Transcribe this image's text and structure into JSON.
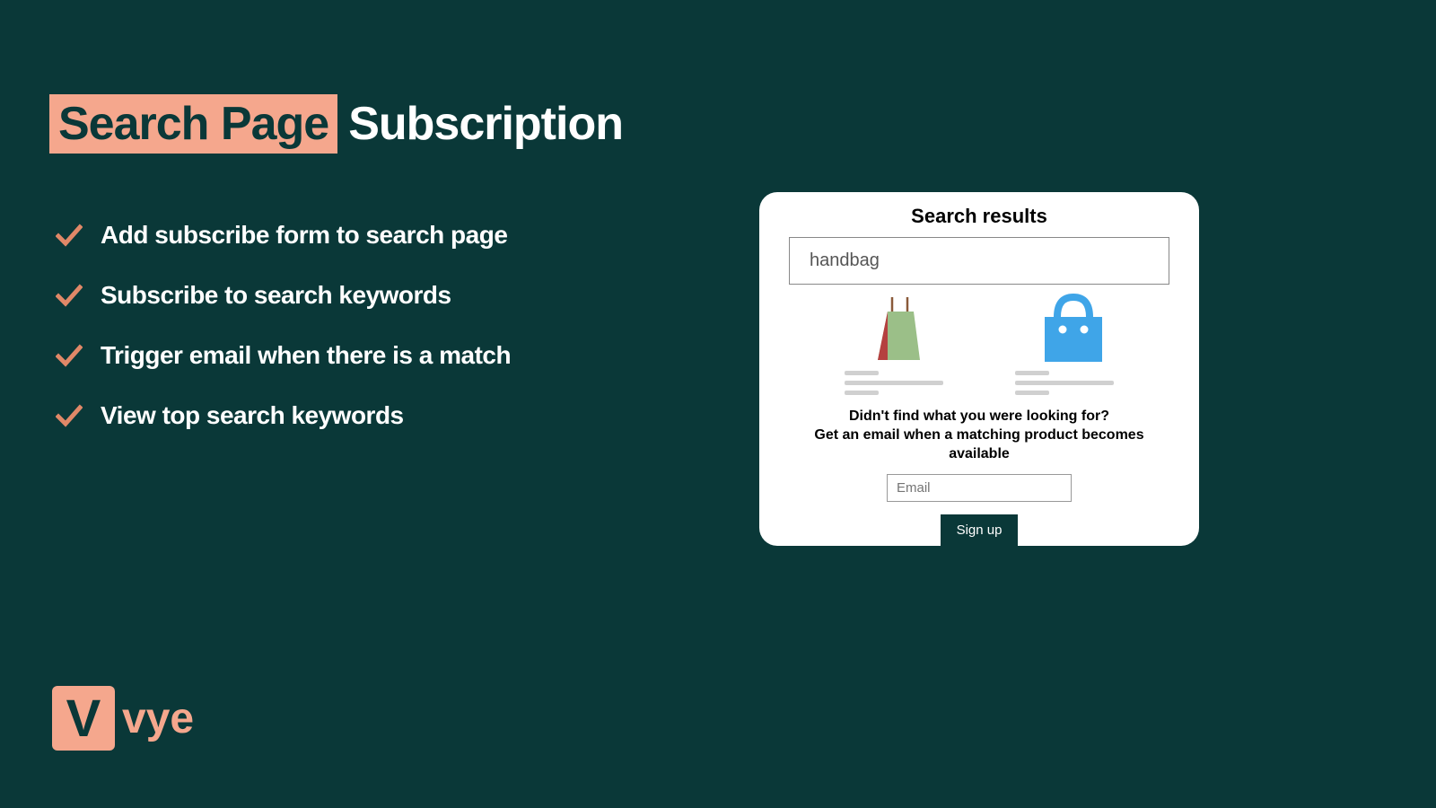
{
  "title": {
    "highlight": "Search Page",
    "rest": "Subscription"
  },
  "features": [
    "Add subscribe form to search page",
    "Subscribe to search keywords",
    "Trigger email when there is a match",
    "View top search keywords"
  ],
  "card": {
    "title": "Search results",
    "search_value": "handbag",
    "prompt_line1": "Didn't find what you were looking for?",
    "prompt_line2": "Get an email when a matching product becomes available",
    "email_placeholder": "Email",
    "signup_label": "Sign up"
  },
  "logo": {
    "letter": "V",
    "text": "vye"
  },
  "colors": {
    "bg": "#0a3838",
    "accent": "#f5a78d"
  }
}
